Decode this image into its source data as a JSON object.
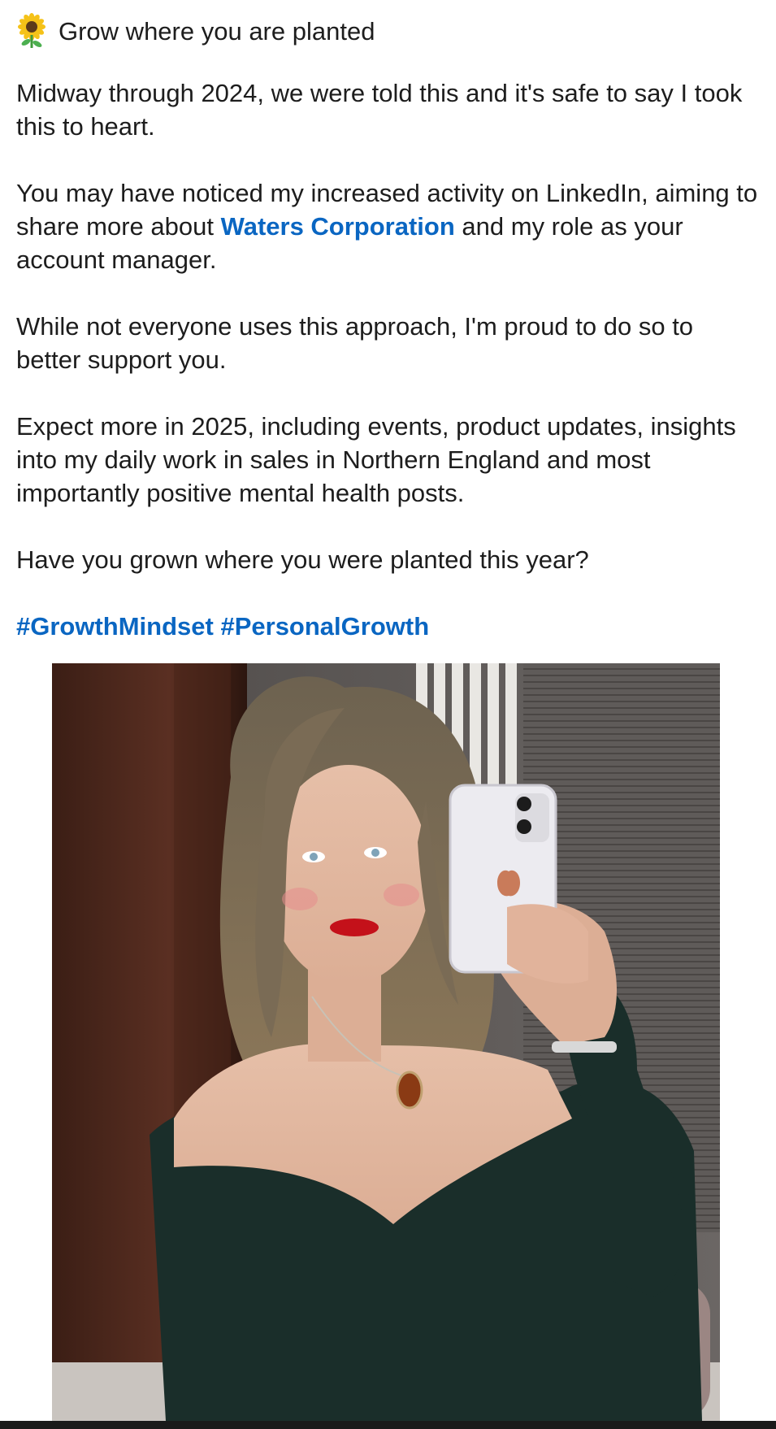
{
  "post": {
    "headline": "Grow where you are planted",
    "headline_icon": "sunflower-icon",
    "paragraph_1": "Midway through 2024, we were told this and it's safe to say I took this to heart.",
    "paragraph_2_before": "You may have noticed my increased activity on LinkedIn, aiming to share more about ",
    "paragraph_2_link": "Waters Corporation",
    "paragraph_2_after": " and my role as your account manager.",
    "paragraph_3": "While not everyone uses this approach, I'm proud to do so to better support you.",
    "paragraph_4": "Expect more in 2025, including events, product updates, insights into my daily work in sales in Northern England and most importantly positive mental health posts.",
    "paragraph_5": "Have you grown where you were planted this year?",
    "hashtags": [
      "#GrowthMindset",
      "#PersonalGrowth"
    ]
  },
  "colors": {
    "link": "#0a66c2",
    "text": "#1d1d1d",
    "background": "#ffffff"
  }
}
